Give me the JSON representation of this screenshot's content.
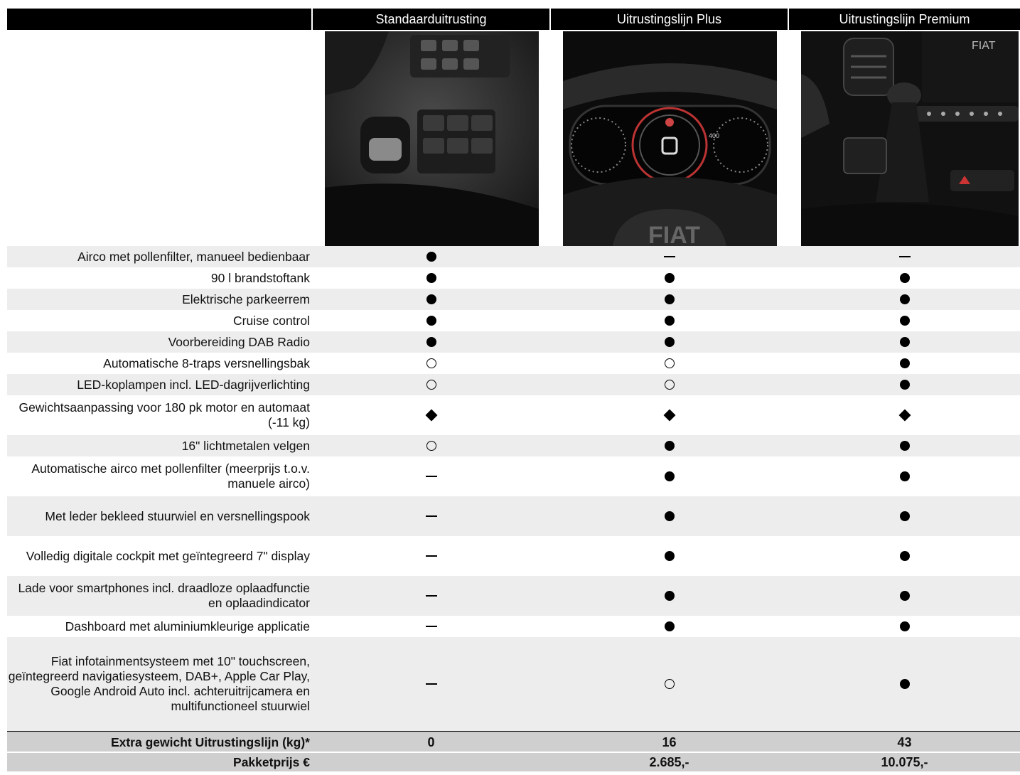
{
  "columns": [
    "Standaarduitrusting",
    "Uitrustingslijn Plus",
    "Uitrustingslijn Premium"
  ],
  "images": [
    "gear-lever-interior-image",
    "digital-cockpit-image",
    "automatic-shifter-image"
  ],
  "symbols": {
    "filled": "standard-dot-icon",
    "open": "optional-circle-icon",
    "diamond": "weight-diamond-icon",
    "dash": "not-available-dash-icon"
  },
  "rows": [
    {
      "label": "Airco met pollenfilter, manueel bedienbaar",
      "values": [
        "filled",
        "dash",
        "dash"
      ]
    },
    {
      "label": "90 l brandstoftank",
      "values": [
        "filled",
        "filled",
        "filled"
      ]
    },
    {
      "label": "Elektrische parkeerrem",
      "values": [
        "filled",
        "filled",
        "filled"
      ]
    },
    {
      "label": "Cruise control",
      "values": [
        "filled",
        "filled",
        "filled"
      ]
    },
    {
      "label": "Voorbereiding DAB Radio",
      "values": [
        "filled",
        "filled",
        "filled"
      ]
    },
    {
      "label": "Automatische 8-traps versnellingsbak",
      "values": [
        "open",
        "open",
        "filled"
      ]
    },
    {
      "label": "LED-koplampen incl. LED-dagrijverlichting",
      "values": [
        "open",
        "open",
        "filled"
      ]
    },
    {
      "label": "Gewichtsaanpassing voor 180 pk motor en automaat (-11 kg)",
      "values": [
        "diamond",
        "diamond",
        "diamond"
      ]
    },
    {
      "label": "16\" lichtmetalen velgen",
      "values": [
        "open",
        "filled",
        "filled"
      ]
    },
    {
      "label": "Automatische airco met pollenfilter (meerprijs t.o.v. manuele airco)",
      "values": [
        "dash",
        "filled",
        "filled"
      ]
    },
    {
      "label": "Met leder bekleed stuurwiel en versnellingspook",
      "values": [
        "dash",
        "filled",
        "filled"
      ]
    },
    {
      "label": "Volledig digitale cockpit met geïntegreerd 7\" display",
      "values": [
        "dash",
        "filled",
        "filled"
      ]
    },
    {
      "label": "Lade voor smartphones incl. draadloze oplaadfunctie en oplaadindicator",
      "values": [
        "dash",
        "filled",
        "filled"
      ]
    },
    {
      "label": "Dashboard met aluminiumkleurige applicatie",
      "values": [
        "dash",
        "filled",
        "filled"
      ]
    },
    {
      "label": "Fiat infotainmentsysteem met 10\" touchscreen, geïntegreerd navigatiesysteem, DAB+, Apple Car Play, Google Android Auto incl. achteruitrijcamera en multifunctioneel stuurwiel",
      "values": [
        "dash",
        "open",
        "filled"
      ]
    }
  ],
  "totals": [
    {
      "label": "Extra gewicht Uitrustingslijn (kg)*",
      "values": [
        "0",
        "16",
        "43"
      ]
    },
    {
      "label": "Pakketprijs €",
      "values": [
        "",
        "2.685,-",
        "10.075,-"
      ]
    }
  ],
  "colors": {
    "header_bg": "#000000",
    "stripe": "#ededed",
    "total_bg": "#cfcfcf"
  }
}
